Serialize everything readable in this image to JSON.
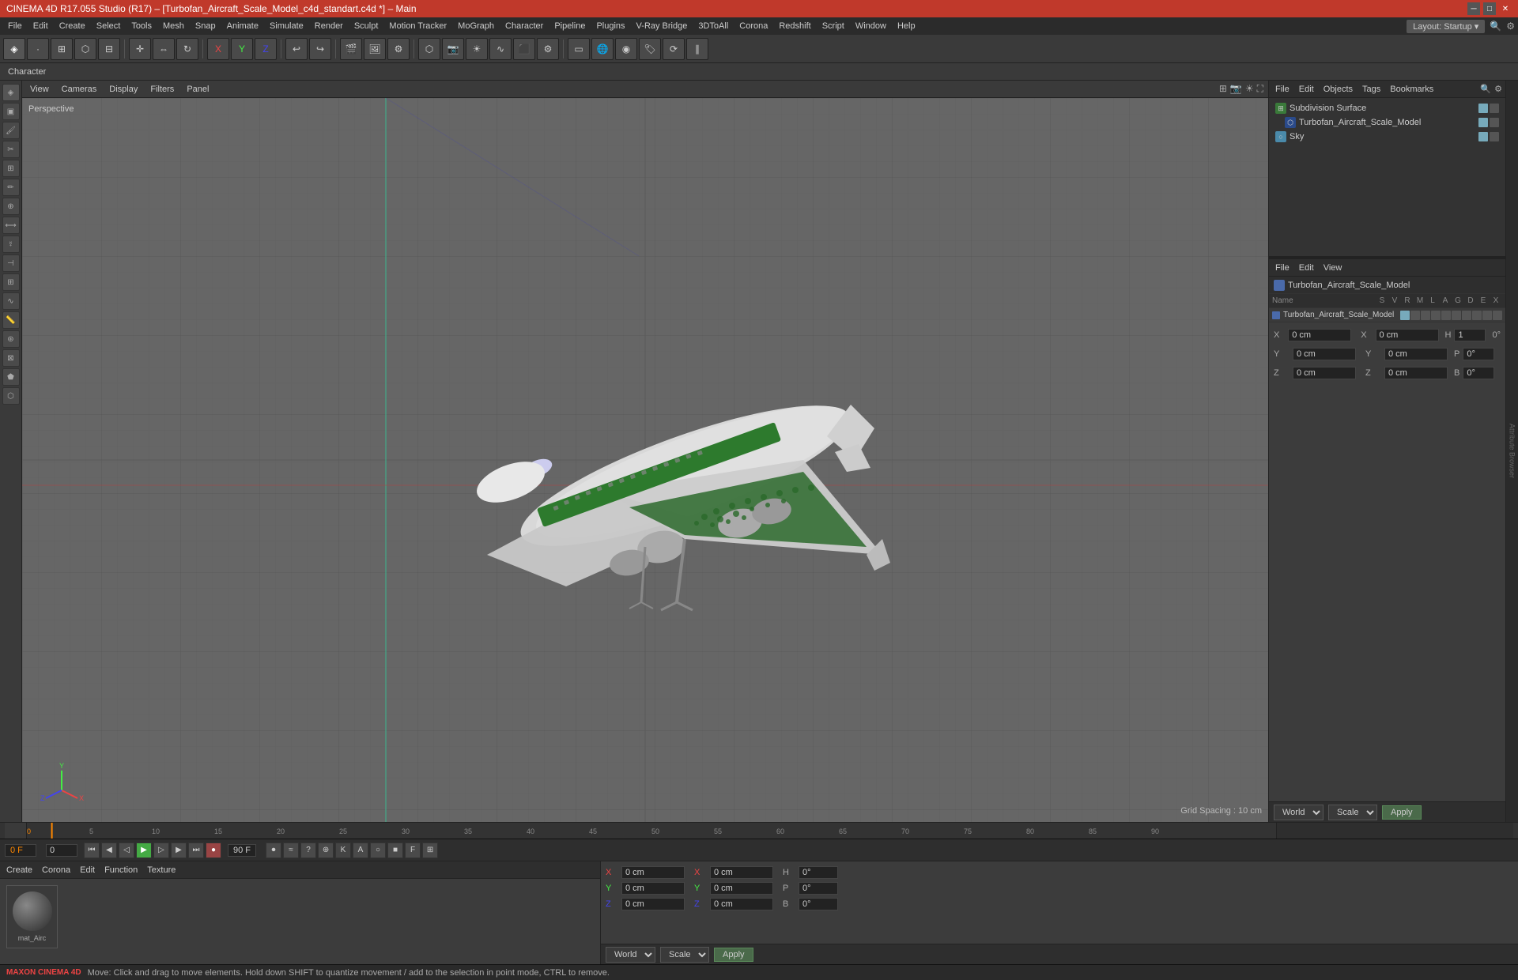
{
  "titlebar": {
    "title": "CINEMA 4D R17.055 Studio (R17) – [Turbofan_Aircraft_Scale_Model_c4d_standart.c4d *] – Main",
    "layout_label": "Layout: Startup"
  },
  "menubar": {
    "items": [
      "File",
      "Edit",
      "Create",
      "Select",
      "Tools",
      "Mesh",
      "Snap",
      "Animate",
      "Simulate",
      "Render",
      "Sculpt",
      "Motion Tracker",
      "MoGraph",
      "Character",
      "Pipeline",
      "Plugins",
      "V-Ray Bridge",
      "3DToAll",
      "Corona",
      "Redshift",
      "Script",
      "Window",
      "Help"
    ]
  },
  "secondary_toolbar": {
    "items": [
      "Character"
    ]
  },
  "viewport": {
    "label": "Perspective",
    "menu_items": [
      "View",
      "Cameras",
      "Display",
      "Filters",
      "Panel"
    ],
    "grid_spacing": "Grid Spacing : 10 cm"
  },
  "object_manager": {
    "menu_items": [
      "File",
      "Edit",
      "Objects",
      "Tags",
      "Bookmarks"
    ],
    "objects": [
      {
        "name": "Subdivision Surface",
        "icon": "green",
        "level": 0,
        "checked": true
      },
      {
        "name": "Turbofan_Aircraft_Scale_Model",
        "icon": "blue",
        "level": 1,
        "checked": true
      },
      {
        "name": "Sky",
        "icon": "sky",
        "level": 0,
        "checked": true
      }
    ]
  },
  "attribute_manager": {
    "menu_items": [
      "File",
      "Edit",
      "View"
    ],
    "selected_object": "Turbofan_Aircraft_Scale_Model",
    "coords": {
      "x_pos": "0 cm",
      "y_pos": "0 cm",
      "z_pos": "0 cm",
      "x_rot": "0°",
      "y_rot": "0°",
      "z_rot": "0°",
      "h": "1",
      "p": "0°",
      "b": "0°"
    },
    "columns": [
      "Name",
      "S",
      "V",
      "R",
      "M",
      "L",
      "A",
      "G",
      "D",
      "E",
      "X"
    ]
  },
  "material_manager": {
    "menu_items": [
      "Create",
      "Corona",
      "Edit",
      "Function",
      "Texture"
    ],
    "materials": [
      {
        "name": "mat_Airc"
      }
    ]
  },
  "coord_bar": {
    "world_label": "World",
    "scale_label": "Scale",
    "apply_label": "Apply"
  },
  "timeline": {
    "current_frame": "0 F",
    "end_frame": "90 F",
    "ticks": [
      "0",
      "5",
      "10",
      "15",
      "20",
      "25",
      "30",
      "35",
      "40",
      "45",
      "50",
      "55",
      "60",
      "65",
      "70",
      "75",
      "80",
      "85",
      "90"
    ]
  },
  "status_bar": {
    "message": "Move: Click and drag to move elements. Hold down SHIFT to quantize movement / add to the selection in point mode, CTRL to remove."
  },
  "icons": {
    "undo": "↩",
    "redo": "↪",
    "play": "▶",
    "stop": "■",
    "record": "●",
    "prev_frame": "◀",
    "next_frame": "▶",
    "first_frame": "⏮",
    "last_frame": "⏭",
    "new_obj": "+",
    "delete": "✕",
    "axes_x": "X",
    "axes_y": "Y",
    "axes_z": "Z",
    "move": "✛",
    "rotate": "↻",
    "scale": "⇔",
    "lock": "🔒",
    "eye": "👁",
    "cube": "□",
    "sphere": "○",
    "cam": "📷"
  }
}
